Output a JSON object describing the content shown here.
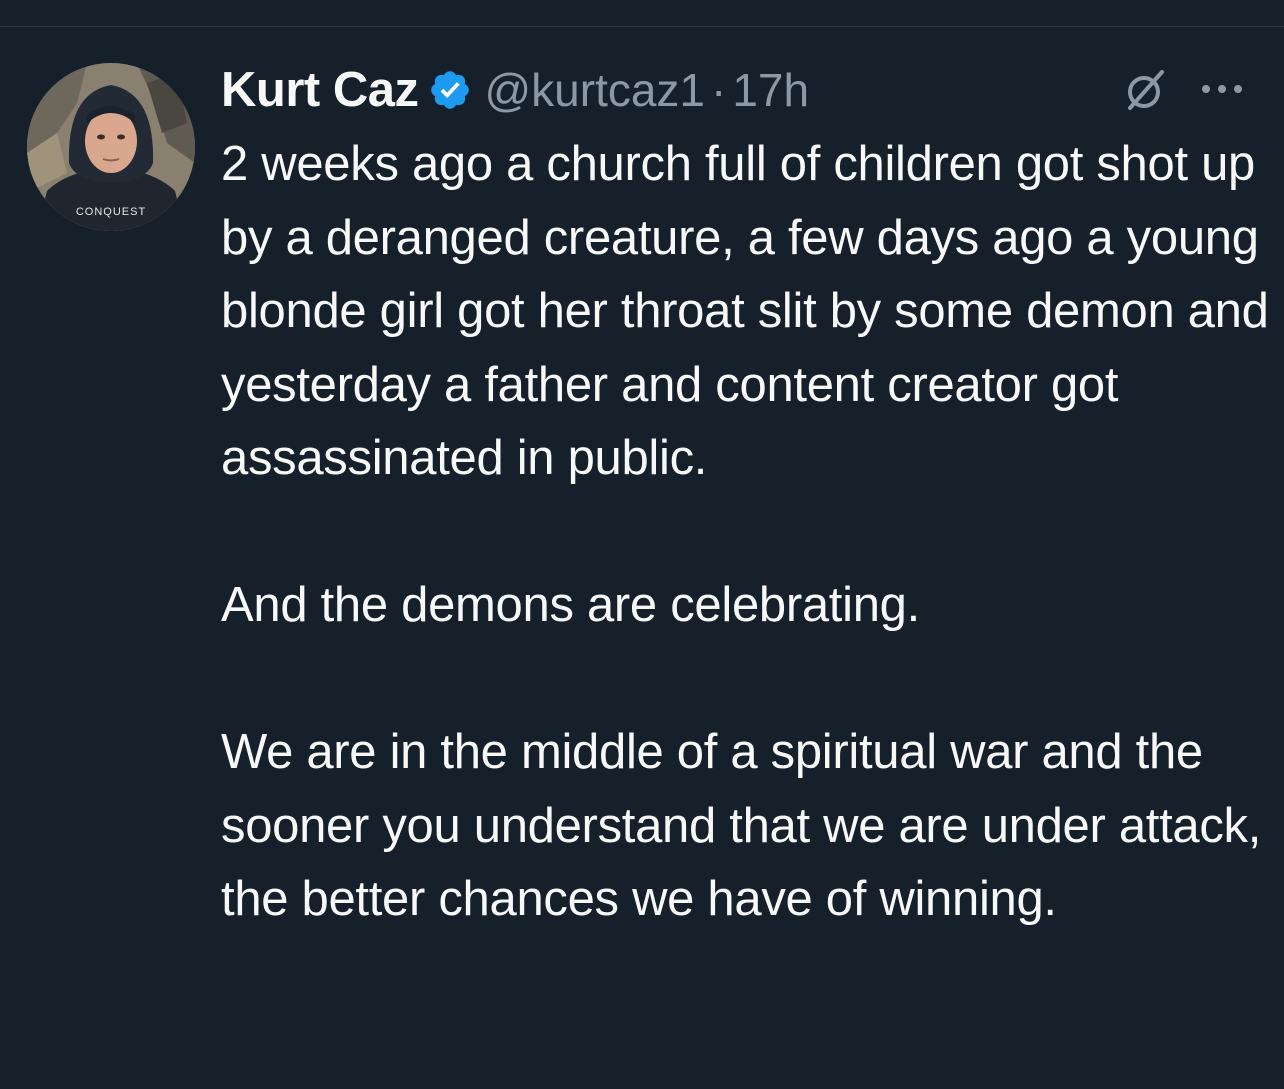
{
  "author": {
    "display_name": "Kurt Caz",
    "handle": "@kurtcaz1",
    "separator": "·",
    "time": "17h",
    "verified": true,
    "avatar_hoodie_text": "CONQUEST"
  },
  "icons": {
    "verified": "verified-badge-icon",
    "grok": "grok-icon",
    "more": "more-options-icon"
  },
  "colors": {
    "background": "#15202b",
    "text_primary": "#f7f9f9",
    "text_secondary": "#8b98a5",
    "verified_blue": "#1d9bf0"
  },
  "tweet": {
    "paragraphs": [
      "2 weeks ago a church full of children got shot up by a deranged creature, a few days ago a young blonde girl got her throat slit by some demon and yesterday a father and content creator got assassinated in public.",
      "And the demons are celebrating.",
      "We are in the middle of a spiritual war and the sooner you understand that we are under attack, the better chances we have of winning."
    ]
  }
}
